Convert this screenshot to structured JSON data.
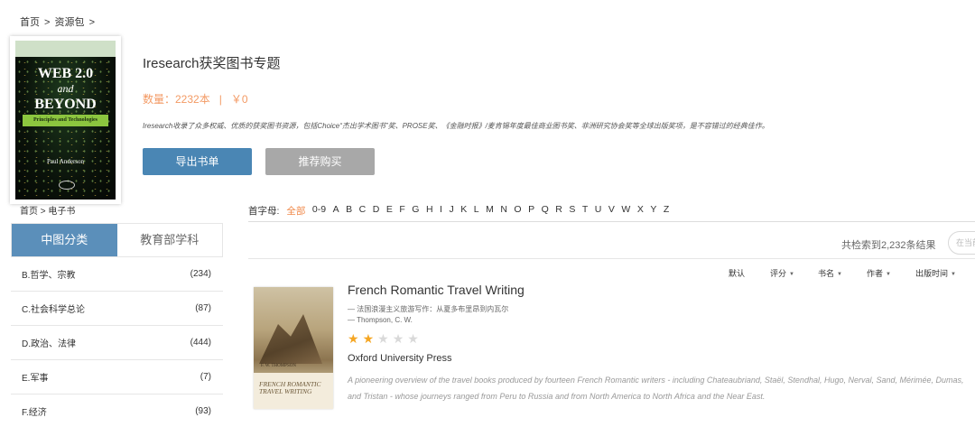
{
  "breadcrumb_top": {
    "home": "首页",
    "sep1": " > ",
    "section": "资源包",
    "sep2": " >"
  },
  "package": {
    "cover": {
      "title_line1": "WEB 2.0",
      "title_and": "and",
      "title_line2": "BEYOND",
      "subtitle": "Principles and Technologies",
      "author": "Paul Anderson"
    },
    "title": "Iresearch获奖图书专题",
    "count_label": "数量：2232本",
    "price_label": "￥0",
    "separator": "|",
    "description": "Iresearch收录了众多权威、优质的获奖图书资源，包括Choice“杰出学术图书”奖、PROSE奖、《金融时报》/麦肯锡年度最佳商业图书奖、非洲研究协会奖等全球出版奖项，是不容错过的经典佳作。",
    "export_button": "导出书单",
    "recommend_button": "推荐购买"
  },
  "breadcrumb_side": {
    "home": "首页",
    "sep": " > ",
    "section": "电子书"
  },
  "side_tabs": [
    {
      "label": "中图分类",
      "active": true
    },
    {
      "label": "教育部学科",
      "active": false
    }
  ],
  "categories": [
    {
      "name": "B.哲学、宗教",
      "count": "(234)"
    },
    {
      "name": "C.社会科学总论",
      "count": "(87)"
    },
    {
      "name": "D.政治、法律",
      "count": "(444)"
    },
    {
      "name": "E.军事",
      "count": "(7)"
    },
    {
      "name": "F.经济",
      "count": "(93)"
    }
  ],
  "letter_filter": {
    "label": "首字母:",
    "items": [
      "全部",
      "0-9",
      "A",
      "B",
      "C",
      "D",
      "E",
      "F",
      "G",
      "H",
      "I",
      "J",
      "K",
      "L",
      "M",
      "N",
      "O",
      "P",
      "Q",
      "R",
      "S",
      "T",
      "U",
      "V",
      "W",
      "X",
      "Y",
      "Z"
    ],
    "active": "全部"
  },
  "results": {
    "count_text": "共检索到2,232条结果",
    "search_placeholder": "在当前"
  },
  "sort_options": [
    "默认",
    "评分",
    "书名",
    "作者",
    "出版时间"
  ],
  "book": {
    "cover_author": "F. W. THOMPSON",
    "cover_title": "FRENCH ROMANTIC TRAVEL WRITING",
    "title": "French Romantic Travel Writing",
    "subtitle_cn": "— 法国浪漫主义旅游写作：从夏多布里昂到内瓦尔",
    "author": "— Thompson, C. W.",
    "rating": 2,
    "rating_max": 5,
    "publisher": "Oxford University Press",
    "description": "A pioneering overview of the travel books produced by fourteen French Romantic writers - including Chateaubriand, Staël, Stendhal, Hugo, Nerval, Sand, Mérimée, Dumas, and Tristan - whose journeys ranged from Peru to Russia and from North America to North Africa and the Near East."
  },
  "colors": {
    "accent_blue": "#4a86b4",
    "accent_orange": "#f08a4b",
    "star": "#f5a623"
  }
}
